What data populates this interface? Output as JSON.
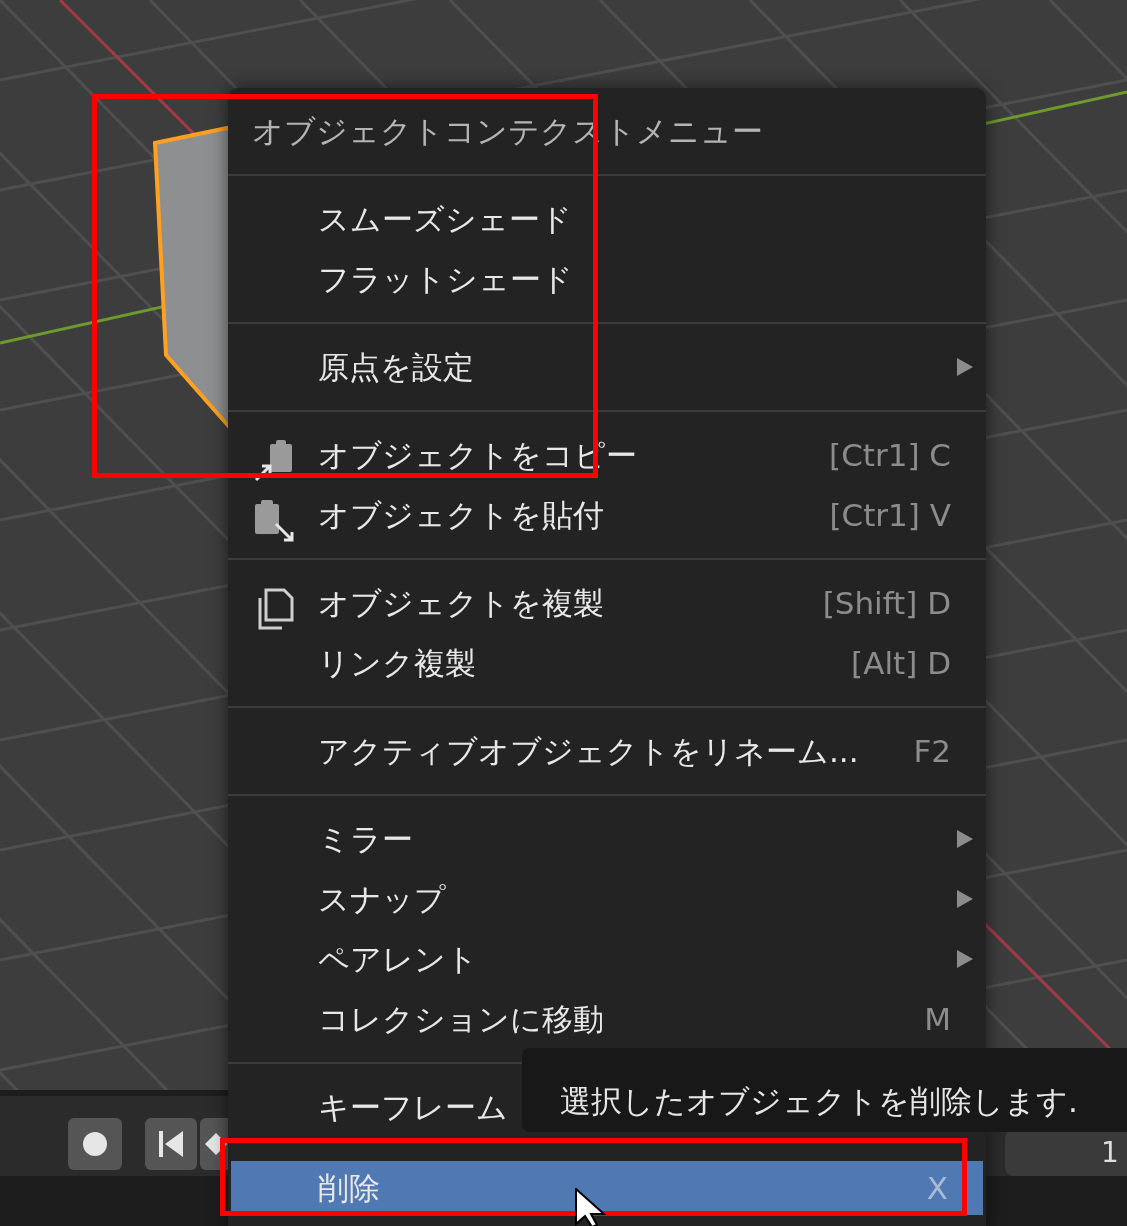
{
  "menu": {
    "title": "オブジェクトコンテクストメニュー",
    "sections": [
      [
        {
          "label": "スムーズシェード",
          "kind": "plain",
          "submenu": false,
          "selected": false
        },
        {
          "label": "フラットシェード",
          "kind": "plain",
          "submenu": false,
          "selected": false
        }
      ],
      [
        {
          "label": "原点を設定",
          "kind": "plain",
          "submenu": true,
          "selected": false
        }
      ],
      [
        {
          "label": "オブジェクトをコピー",
          "kind": "copy",
          "shortcut": "[Ctr1] C",
          "submenu": false,
          "selected": false
        },
        {
          "label": "オブジェクトを貼付",
          "kind": "paste",
          "shortcut": "[Ctr1] V",
          "submenu": false,
          "selected": false
        }
      ],
      [
        {
          "label": "オブジェクトを複製",
          "kind": "duplicate",
          "shortcut": "[Shift] D",
          "submenu": false,
          "selected": false
        },
        {
          "label": "リンク複製",
          "kind": "plain",
          "shortcut": "[Alt] D",
          "submenu": false,
          "selected": false
        }
      ],
      [
        {
          "label": "アクティブオブジェクトをリネーム...",
          "kind": "plain",
          "shortcut": "F2",
          "submenu": false,
          "selected": false
        }
      ],
      [
        {
          "label": "ミラー",
          "kind": "plain",
          "submenu": true,
          "selected": false
        },
        {
          "label": "スナップ",
          "kind": "plain",
          "submenu": true,
          "selected": false
        },
        {
          "label": "ペアレント",
          "kind": "plain",
          "submenu": true,
          "selected": false
        },
        {
          "label": "コレクションに移動",
          "kind": "plain",
          "shortcut": "M",
          "submenu": false,
          "selected": false
        }
      ],
      [
        {
          "label": "キーフレーム",
          "kind": "plain",
          "submenu": false,
          "selected": false
        },
        {
          "label": "削除",
          "kind": "plain",
          "shortcut": "X",
          "submenu": false,
          "selected": true
        }
      ]
    ]
  },
  "tooltip": {
    "text": "選択したオブジェクトを削除します."
  },
  "timeline": {
    "frame_field": "1"
  }
}
